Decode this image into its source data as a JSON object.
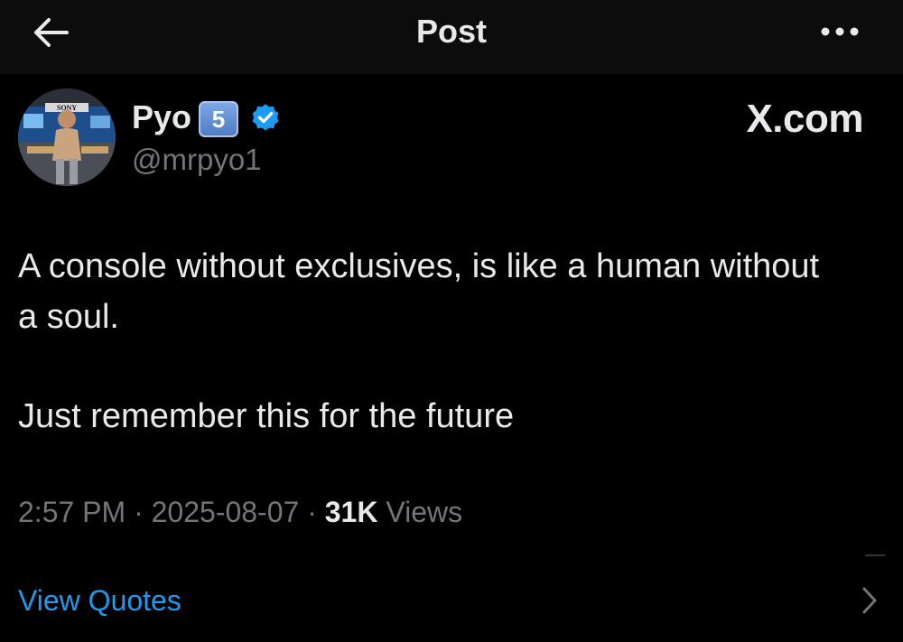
{
  "header": {
    "title": "Post",
    "back_icon": "arrow-left-icon",
    "more_icon": "more-horizontal-icon"
  },
  "author": {
    "display_name": "Pyo",
    "badge_keycap": "5",
    "verified_icon": "verified-badge-icon",
    "handle": "@mrpyo1",
    "avatar_sign_text": "SONY"
  },
  "brand": "X.com",
  "post": {
    "paragraphs": [
      "A console without exclusives, is like a human without a soul.",
      "Just remember this for the future"
    ]
  },
  "meta": {
    "time": "2:57 PM",
    "separator": "·",
    "date": "2025-08-07",
    "views_count": "31K",
    "views_label": "Views"
  },
  "footer": {
    "view_quotes": "View Quotes",
    "chevron_icon": "chevron-right-icon"
  },
  "colors": {
    "background": "#000000",
    "header_background": "#0c0c0c",
    "primary_text": "#e7e9ea",
    "secondary_text": "#71767b",
    "link": "#1d9bf0",
    "verified": "#1d9bf0"
  }
}
